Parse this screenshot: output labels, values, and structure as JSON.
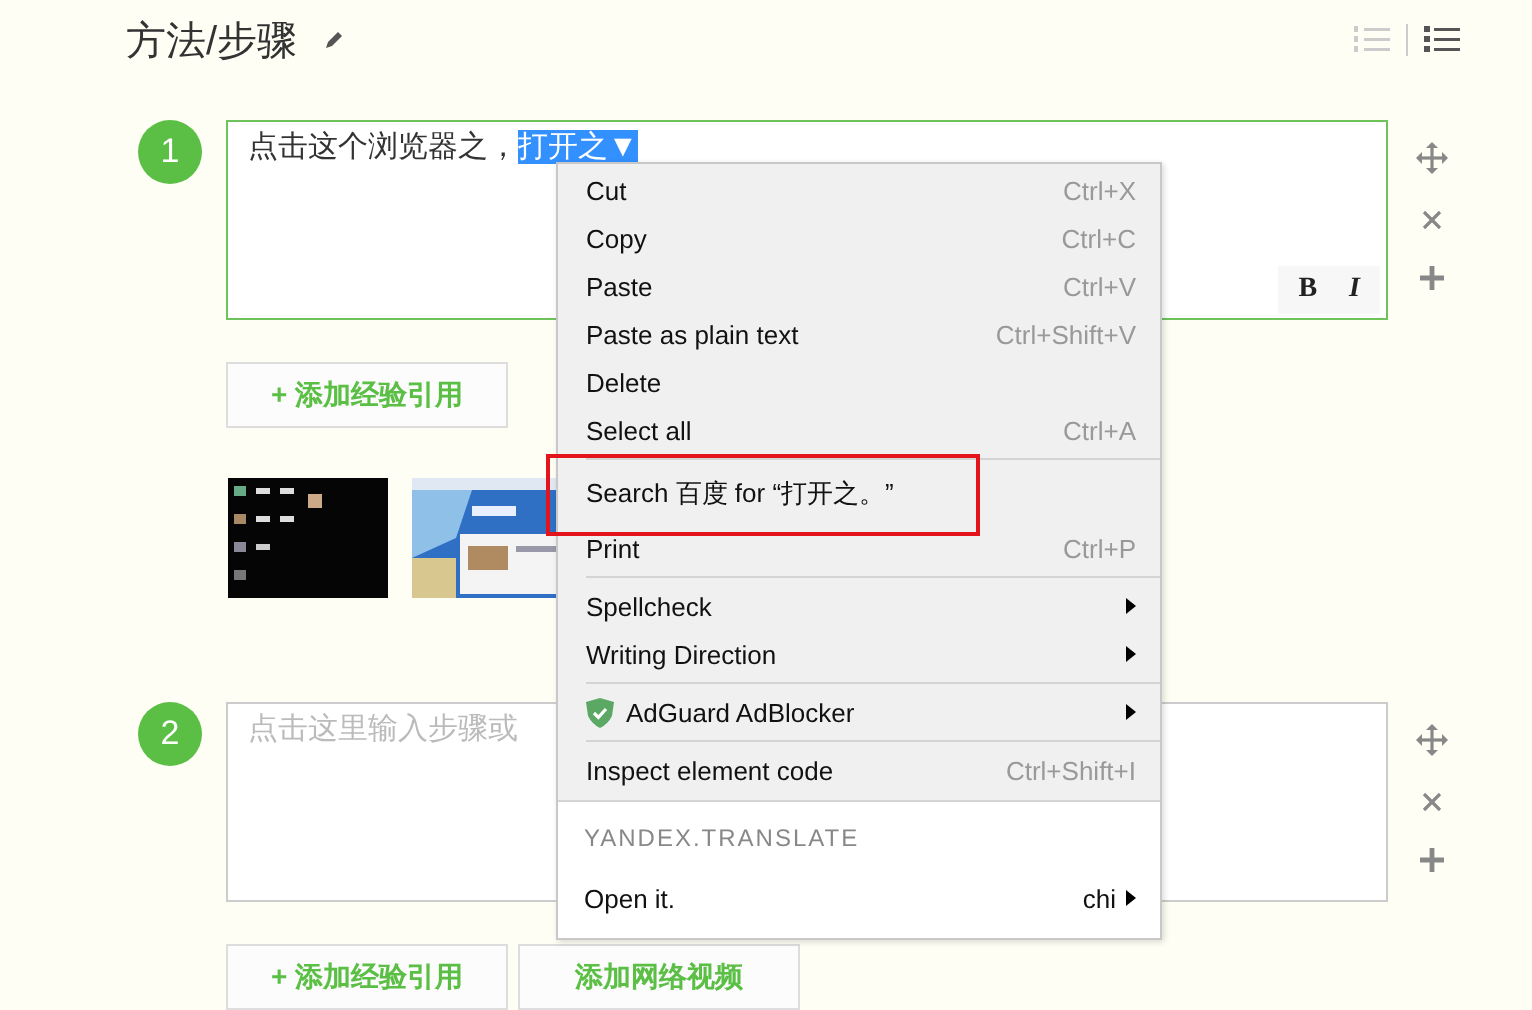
{
  "header": {
    "title": "方法/步骤",
    "list_views": [
      {
        "kind": "numbered",
        "selected": false
      },
      {
        "kind": "bulleted",
        "selected": true
      }
    ]
  },
  "steps": [
    {
      "number": "1",
      "focused": true,
      "text": "点击这个浏览器之，",
      "selection": "打开之▼",
      "format_buttons": [
        "B",
        "I"
      ],
      "buttons": [
        "+ 添加经验引用"
      ],
      "thumbnails": [
        {
          "kind": "picture"
        },
        {
          "kind": "picture"
        }
      ]
    },
    {
      "number": "2",
      "focused": false,
      "placeholder": "点击这里输入步骤或",
      "buttons": [
        "+ 添加经验引用",
        "添加网络视频"
      ]
    }
  ],
  "context_menu": {
    "items": [
      {
        "kind": "item",
        "label": "Cut",
        "shortcut": "Ctrl+X",
        "highlighted": false
      },
      {
        "kind": "item",
        "label": "Copy",
        "shortcut": "Ctrl+C",
        "highlighted": false
      },
      {
        "kind": "item",
        "label": "Paste",
        "shortcut": "Ctrl+V",
        "highlighted": false
      },
      {
        "kind": "item",
        "label": "Paste as plain text",
        "shortcut": "Ctrl+Shift+V",
        "highlighted": false
      },
      {
        "kind": "item",
        "label": "Delete",
        "highlighted": false
      },
      {
        "kind": "item",
        "label": "Select all",
        "shortcut": "Ctrl+A",
        "highlighted": false
      },
      {
        "kind": "separator"
      },
      {
        "kind": "item",
        "label": "Search 百度 for “打开之。”",
        "highlighted": true
      },
      {
        "kind": "item",
        "label": "Print",
        "shortcut": "Ctrl+P",
        "highlighted": false
      },
      {
        "kind": "separator"
      },
      {
        "kind": "submenu",
        "label": "Spellcheck",
        "highlighted": false
      },
      {
        "kind": "submenu",
        "label": "Writing Direction",
        "highlighted": false
      },
      {
        "kind": "separator"
      },
      {
        "kind": "extension",
        "label": "AdGuard AdBlocker",
        "highlighted": false
      },
      {
        "kind": "separator"
      },
      {
        "kind": "item",
        "label": "Inspect element code",
        "shortcut": "Ctrl+Shift+I",
        "highlighted": false
      }
    ],
    "section_title": "YANDEX.TRANSLATE",
    "translate_item": {
      "label": "Open it.",
      "language": "chi"
    }
  }
}
